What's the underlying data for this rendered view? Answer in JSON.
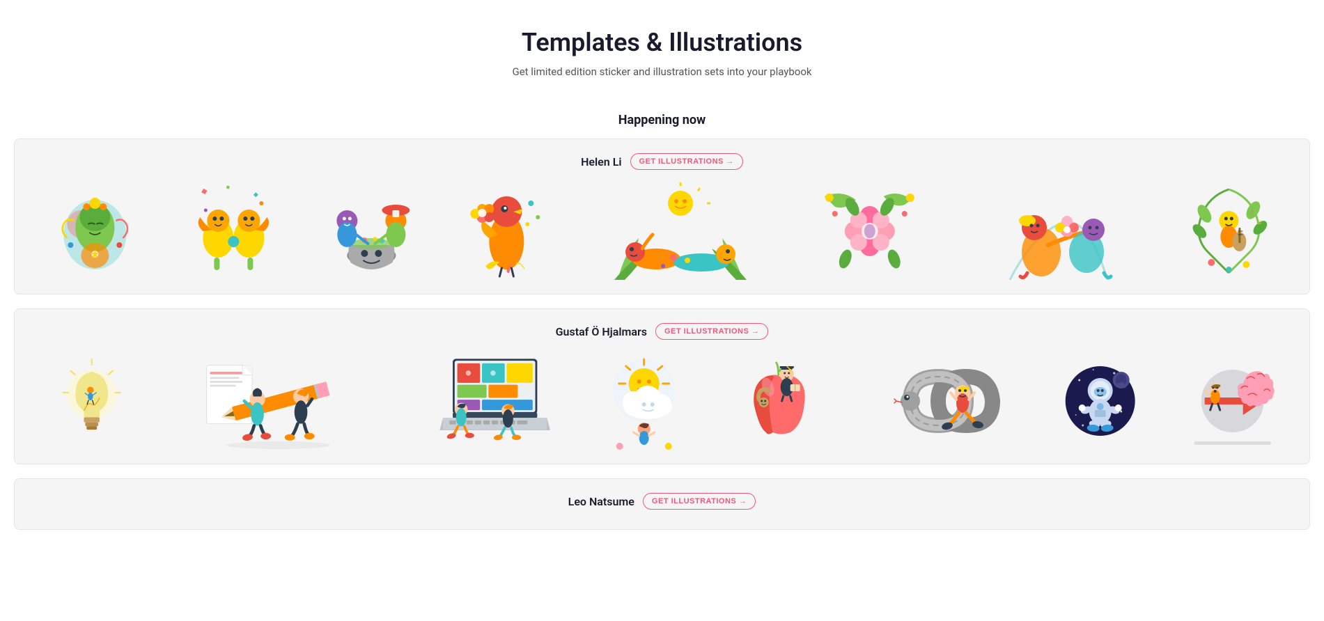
{
  "header": {
    "title": "Templates & Illustrations",
    "subtitle": "Get limited edition sticker and illustration sets into your playbook"
  },
  "happening_now_label": "Happening now",
  "artists": [
    {
      "id": "helen-li",
      "name": "Helen Li",
      "btn_label": "GET ILLUSTRATIONS →",
      "illustrations": [
        {
          "id": "hl-1",
          "label": "Meditating figure with colorful swirls"
        },
        {
          "id": "hl-2",
          "label": "Golden bird creatures with confetti"
        },
        {
          "id": "hl-3",
          "label": "Characters cooking with cauldron"
        },
        {
          "id": "hl-4",
          "label": "Bird character with orange flower"
        },
        {
          "id": "hl-5",
          "label": "Reclining figures with sun"
        },
        {
          "id": "hl-6",
          "label": "Floral decorative letter"
        },
        {
          "id": "hl-7",
          "label": "Intertwined figures with flowers"
        },
        {
          "id": "hl-8",
          "label": "Character playing music with vines"
        }
      ]
    },
    {
      "id": "gustaf-hjalmars",
      "name": "Gustaf Ö Hjalmars",
      "btn_label": "GET ILLUSTRATIONS →",
      "illustrations": [
        {
          "id": "gh-1",
          "label": "Light bulb with tiny person inside"
        },
        {
          "id": "gh-2",
          "label": "People carrying giant pencil"
        },
        {
          "id": "gh-3",
          "label": "Person on giant laptop keyboard"
        },
        {
          "id": "gh-4",
          "label": "Sun and clouds illustration"
        },
        {
          "id": "gh-5",
          "label": "Apple with worm and graduate"
        },
        {
          "id": "gh-6",
          "label": "Snake infinity loop with person"
        },
        {
          "id": "gh-7",
          "label": "Person in space circle"
        },
        {
          "id": "gh-8",
          "label": "Brain and arrow illustration"
        }
      ]
    },
    {
      "id": "leo-natsume",
      "name": "Leo Natsume",
      "btn_label": "GET ILLUSTRATIONS →",
      "illustrations": []
    }
  ],
  "colors": {
    "accent": "#f0587a",
    "title": "#1a1a2e",
    "subtitle": "#555555",
    "card_bg": "#f5f5f5",
    "card_border": "#e5e5e5"
  }
}
